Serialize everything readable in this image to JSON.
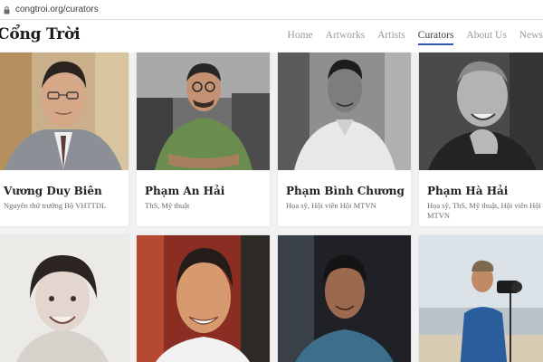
{
  "browser": {
    "url": "congtroi.org/curators"
  },
  "site": {
    "logo": "Cổng Trời"
  },
  "nav": [
    {
      "label": "Home"
    },
    {
      "label": "Artworks"
    },
    {
      "label": "Artists"
    },
    {
      "label": "Curators",
      "active": true
    },
    {
      "label": "About Us"
    },
    {
      "label": "News"
    }
  ],
  "curators": [
    {
      "name": "Vương Duy Biên",
      "role": "Nguyên thứ trưởng Bộ VHTTDL",
      "photo": "curator-photo-vuong-duy-bien"
    },
    {
      "name": "Phạm An Hải",
      "role": "ThS, Mỹ thuật",
      "photo": "curator-photo-pham-an-hai"
    },
    {
      "name": "Phạm Bình Chương",
      "role": "Họa sỹ, Hội viên Hội MTVN",
      "photo": "curator-photo-pham-binh-chuong"
    },
    {
      "name": "Phạm Hà Hải",
      "role": "Họa sỹ, ThS, Mỹ thuật, Hội viên Hội MTVN",
      "photo": "curator-photo-pham-ha-hai"
    },
    {
      "name": "",
      "role": "",
      "photo": "curator-photo-woman-sketch"
    },
    {
      "name": "",
      "role": "",
      "photo": "curator-photo-smiling-man"
    },
    {
      "name": "",
      "role": "",
      "photo": "curator-photo-man-dark-background"
    },
    {
      "name": "",
      "role": "",
      "photo": "curator-photo-photographer-outdoors"
    }
  ]
}
